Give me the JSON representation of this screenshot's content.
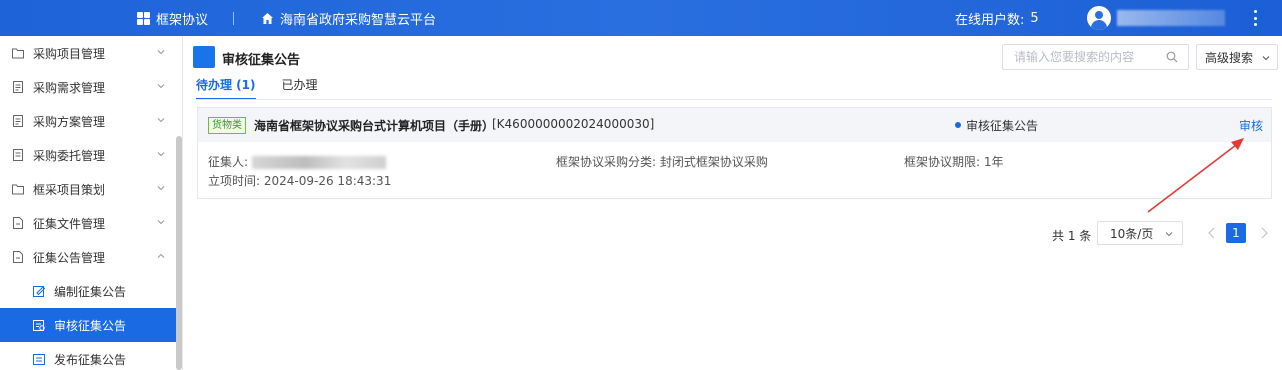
{
  "topbar": {
    "system_label": "框架协议",
    "platform_name": "海南省政府采购智慧云平台",
    "online_label": "在线用户数:",
    "online_count": "5"
  },
  "sidebar": {
    "items": [
      {
        "label": "采购项目管理",
        "expanded": false
      },
      {
        "label": "采购需求管理",
        "expanded": false
      },
      {
        "label": "采购方案管理",
        "expanded": false
      },
      {
        "label": "采购委托管理",
        "expanded": false
      },
      {
        "label": "框采项目策划",
        "expanded": false
      },
      {
        "label": "征集文件管理",
        "expanded": false
      },
      {
        "label": "征集公告管理",
        "expanded": true
      }
    ],
    "subitems": [
      {
        "label": "编制征集公告",
        "active": false
      },
      {
        "label": "审核征集公告",
        "active": true
      },
      {
        "label": "发布征集公告",
        "active": false
      }
    ]
  },
  "main": {
    "title": "审核征集公告",
    "search_placeholder": "请输入您要搜索的内容",
    "advanced_search_label": "高级搜索",
    "tabs": [
      {
        "label": "待办理 (1)",
        "active": true
      },
      {
        "label": "已办理",
        "active": false
      }
    ],
    "card": {
      "tag": "货物类",
      "project_name": "海南省框架协议采购台式计算机项目（手册）",
      "project_code": "[K4600000002024000030]",
      "status": "审核征集公告",
      "action_label": "审核",
      "collector_label": "征集人:",
      "category_label": "框架协议采购分类:",
      "category_value": "封闭式框架协议采购",
      "term_label": "框架协议期限:",
      "term_value": "1年",
      "created_label": "立项时间:",
      "created_value": "2024-09-26 18:43:31"
    },
    "pagination": {
      "total_label": "共 1 条",
      "page_size_label": "10条/页",
      "current_page": "1"
    }
  },
  "colors": {
    "primary": "#1a6be3",
    "topbar": "#2a6fe0",
    "tag_green": "#67c23a",
    "annotation_arrow": "#e53935"
  }
}
